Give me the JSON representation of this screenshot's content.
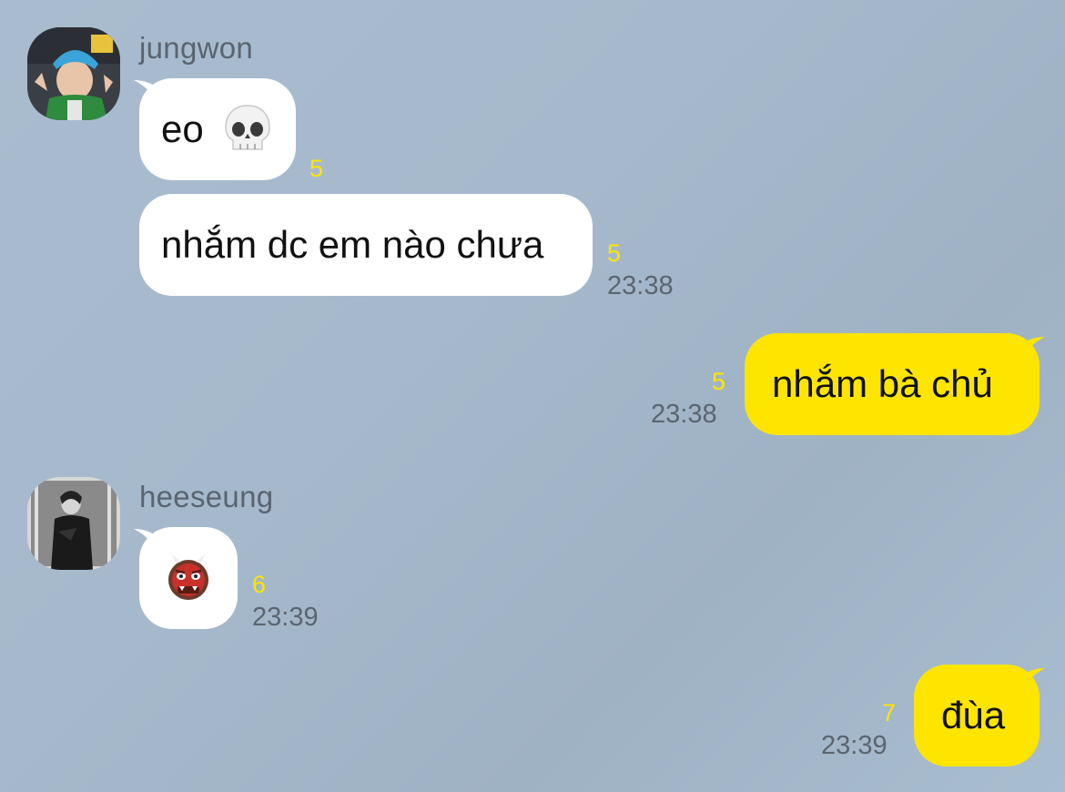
{
  "messages": [
    {
      "sender": "jungwon",
      "text": "eo",
      "emoji": "skull-emoji",
      "unread": "5",
      "time": ""
    },
    {
      "sender": "jungwon",
      "text": "nhắm dc em nào chưa",
      "unread": "5",
      "time": "23:38"
    },
    {
      "sender": "me",
      "text": "nhắm bà chủ",
      "unread": "5",
      "time": "23:38"
    },
    {
      "sender": "heeseung",
      "text": "",
      "emoji": "ogre-emoji",
      "unread": "6",
      "time": "23:39"
    },
    {
      "sender": "me",
      "text": "đùa",
      "unread": "7",
      "time": "23:39"
    }
  ],
  "senders": {
    "jungwon": "jungwon",
    "heeseung": "heeseung"
  },
  "colors": {
    "background": "#a9bccf",
    "incoming": "#ffffff",
    "outgoing": "#fee500",
    "unread": "#fee500",
    "time": "#5b6570"
  }
}
